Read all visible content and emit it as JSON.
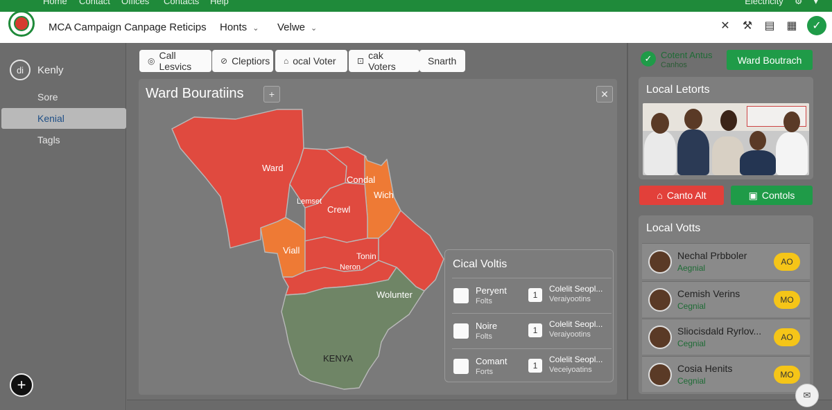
{
  "menu": {
    "items": [
      "Home",
      "Contact",
      "Offices",
      "Contacts",
      "Help"
    ],
    "right_label": "Electricity"
  },
  "header": {
    "title": "MCA Campaign Canpage Reticips",
    "menus": [
      {
        "label": "Honts"
      },
      {
        "label": "Velwe"
      }
    ]
  },
  "sidebar": {
    "brand": "Kenly",
    "items": [
      {
        "label": "Sore"
      },
      {
        "label": "Kenial"
      },
      {
        "label": "Tagls"
      }
    ]
  },
  "toolbar": {
    "chips": [
      "Call Lesvics",
      "Cleptiors",
      "ocal Voter",
      "cak Voters",
      "Snarth"
    ]
  },
  "map": {
    "title": "Ward Bouratiins",
    "labels": [
      "Ward",
      "Condal",
      "Wich",
      "Lemset",
      "Crewl",
      "Viall",
      "Tonin",
      "Neron",
      "Wolunter",
      "KENYA"
    ]
  },
  "overlay": {
    "title": "Cical Voltis",
    "rows": [
      {
        "name": "Peryent",
        "sub": "Folts",
        "num": "1",
        "title": "Colelit Seopl...",
        "detail": "Veraiyootins"
      },
      {
        "name": "Noire",
        "sub": "Folts",
        "num": "1",
        "title": "Colelit Seopl...",
        "detail": "Veraiyootins"
      },
      {
        "name": "Comant",
        "sub": "Forts",
        "num": "1",
        "title": "Colelit Seopl...",
        "detail": "Veceiyoatins"
      }
    ]
  },
  "status": {
    "line1": "Cotent Antus",
    "line2": "Canhos"
  },
  "ward_button": "Ward Boutrach",
  "local_letorts": {
    "title": "Local Letorts"
  },
  "actions": {
    "red": "Canto Alt",
    "green": "Contols"
  },
  "local_volts": {
    "title": "Local Votts",
    "rows": [
      {
        "name": "Nechal Prbboler",
        "sub": "Aegnial",
        "badge": "AO"
      },
      {
        "name": "Cemish Verins",
        "sub": "Cegnial",
        "badge": "MO"
      },
      {
        "name": "Sliocisdald Ryrlov...",
        "sub": "Cegnial",
        "badge": "AO"
      },
      {
        "name": "Cosia Henits",
        "sub": "Cegnial",
        "badge": "MO"
      }
    ]
  },
  "colors": {
    "accent_green": "#1f9b48",
    "map_red": "#e04a3f",
    "map_orange": "#ee7a35",
    "map_green": "#6f8566",
    "badge_yellow": "#f5c518"
  }
}
